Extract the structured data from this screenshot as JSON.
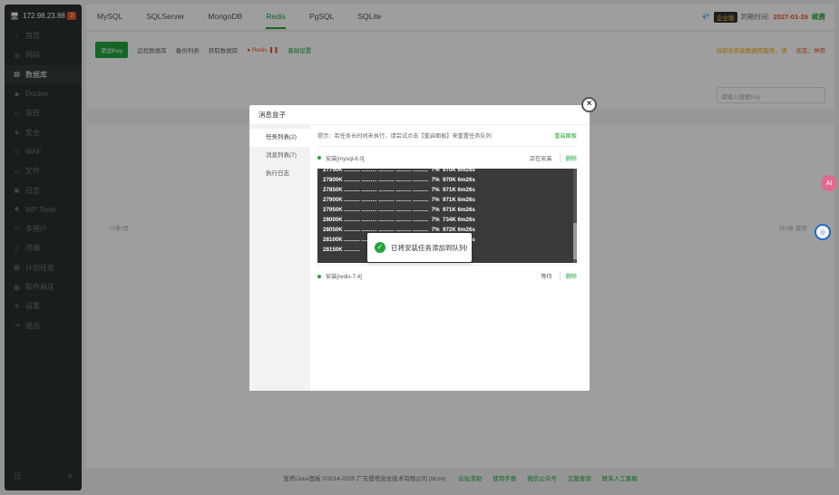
{
  "sidebar": {
    "ip": "172.98.23.88",
    "badge": "2",
    "items": [
      {
        "label": "首页",
        "icon": "home-icon",
        "glyph": "⌂"
      },
      {
        "label": "网站",
        "icon": "globe-icon",
        "glyph": "◍"
      },
      {
        "label": "数据库",
        "icon": "database-icon",
        "glyph": "▤"
      },
      {
        "label": "Docker",
        "icon": "docker-icon",
        "glyph": "◆"
      },
      {
        "label": "监控",
        "icon": "monitor-icon",
        "glyph": "▭"
      },
      {
        "label": "安全",
        "icon": "shield-icon",
        "glyph": "◈"
      },
      {
        "label": "WAF",
        "icon": "waf-icon",
        "glyph": "◇"
      },
      {
        "label": "文件",
        "icon": "folder-icon",
        "glyph": "▱"
      },
      {
        "label": "日志",
        "icon": "log-icon",
        "glyph": "▣"
      },
      {
        "label": "WP Tools",
        "icon": "wordpress-icon",
        "glyph": "✱"
      },
      {
        "label": "多用户",
        "icon": "users-icon",
        "glyph": "☺"
      },
      {
        "label": "终端",
        "icon": "terminal-icon",
        "glyph": "▯"
      },
      {
        "label": "计划任务",
        "icon": "calendar-icon",
        "glyph": "▦"
      },
      {
        "label": "软件商店",
        "icon": "store-icon",
        "glyph": "▩"
      },
      {
        "label": "设置",
        "icon": "gear-icon",
        "glyph": "✲"
      },
      {
        "label": "退出",
        "icon": "logout-icon",
        "glyph": "⇥"
      }
    ],
    "active_index": 2
  },
  "topnav": {
    "tabs": [
      "MySQL",
      "SQLServer",
      "MongoDB",
      "Redis",
      "PgSQL",
      "SQLite"
    ],
    "active_index": 3,
    "vip_label": "企业版",
    "expire_label": "到期时间:",
    "expire_date": "2027-01-26",
    "renew_label": "续费"
  },
  "content": {
    "add_button": "添加Key",
    "toolbar_items": [
      "远程数据库",
      "备份列表",
      "获取数据库"
    ],
    "redis_label": "Redis",
    "green_link": "基础设置",
    "warn_text": "当前未安装数据库服务，请",
    "status_label": "状态：停用",
    "search_placeholder": "请输入搜索Key",
    "pagination_size": "10条/页",
    "pagination_total": "共0条 跳转"
  },
  "footer": {
    "copyright": "宝塔Linux面板 ©2014-2025 广东堡塔安全技术有限公司 (bt.cn)",
    "links": [
      "论坛求助",
      "使用手册",
      "微信公众号",
      "正版查询",
      "联系人工客服"
    ]
  },
  "modal": {
    "title": "消息盒子",
    "side_items": [
      "任务列表(2)",
      "消息列表(7)",
      "执行日志"
    ],
    "side_active": 0,
    "tip": "提示：若任务长时间未执行，请尝试点击【重启面板】来重置任务队列",
    "restart_label": "重启面板",
    "task1": {
      "name": "安装[mysql-8.0]",
      "status": "正在安装",
      "delete": "删除"
    },
    "log_lines": [
      "27750K .......... .......... .......... .......... ..........  7%  970K 6m26s",
      "27800K .......... .......... .......... .......... ..........  7%  970K 6m26s",
      "27850K .......... .......... .......... .......... ..........  7%  971K 6m26s",
      "27900K .......... .......... .......... .......... ..........  7%  971K 6m26s",
      "27950K .......... .......... .......... .......... ..........  7%  971K 6m26s",
      "28000K .......... .......... .......... .......... ..........  7%  734K 6m26s",
      "28050K .......... .......... .......... .......... ..........  7%  972K 6m26s",
      "28100K .......... .......... .......... .......... ..........  7%  972K 6m26s",
      "28150K .........."
    ],
    "task2": {
      "name": "安装[redis-7.4]",
      "status": "等待",
      "delete": "删除"
    }
  },
  "toast": {
    "text": "已将安装任务添加到队列!"
  },
  "float": {
    "icon1": "AI",
    "icon2": "◎"
  },
  "colors": {
    "accent": "#20a53a",
    "warning": "#e8542c",
    "sidebar": "#293130"
  }
}
